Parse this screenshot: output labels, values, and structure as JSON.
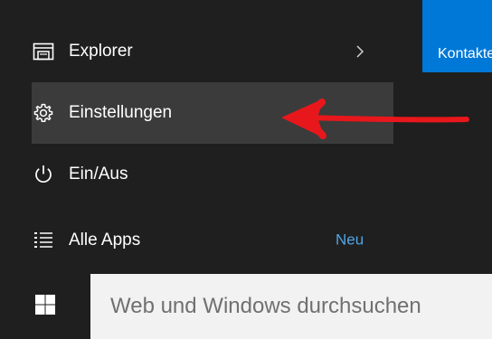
{
  "start_menu": {
    "items": [
      {
        "label": "Explorer",
        "icon": "file-explorer-icon",
        "has_submenu": true
      },
      {
        "label": "Einstellungen",
        "icon": "gear-icon",
        "highlighted": true
      },
      {
        "label": "Ein/Aus",
        "icon": "power-icon"
      },
      {
        "label": "Alle Apps",
        "icon": "list-icon",
        "badge": "Neu"
      }
    ]
  },
  "tile": {
    "label": "Kontakte",
    "color": "#0078d7"
  },
  "annotation": {
    "arrow_color": "#e8171b",
    "points_to": "Einstellungen"
  },
  "taskbar": {
    "start_icon": "windows-logo-icon",
    "search_placeholder": "Web und Windows durchsuchen"
  },
  "colors": {
    "menu_background": "#1f1f1f",
    "highlight_background": "#3b3b3b",
    "accent": "#0078d7",
    "badge_text": "#4fa6e8"
  }
}
